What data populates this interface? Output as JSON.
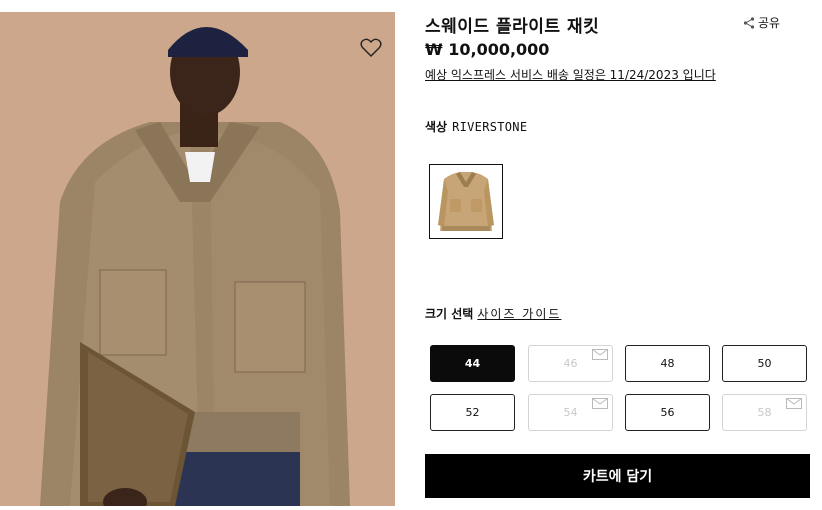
{
  "product": {
    "title": "스웨이드 플라이트 재킷",
    "price": "₩ 10,000,000",
    "delivery_note": "예상 익스프레스 서비스 배송 일정은 11/24/2023 입니다",
    "share_label": "공유"
  },
  "color": {
    "label": "색상",
    "value": "RIVERSTONE",
    "swatch_color": "#c8a576"
  },
  "size": {
    "label": "크기 선택",
    "guide_label": "사이즈 가이드",
    "options": [
      {
        "label": "44",
        "state": "selected"
      },
      {
        "label": "46",
        "state": "unavailable"
      },
      {
        "label": "48",
        "state": "available"
      },
      {
        "label": "50",
        "state": "available"
      },
      {
        "label": "52",
        "state": "available"
      },
      {
        "label": "54",
        "state": "unavailable"
      },
      {
        "label": "56",
        "state": "available"
      },
      {
        "label": "58",
        "state": "unavailable"
      }
    ]
  },
  "cart_button": "카트에 담기",
  "icons": [
    "heart-icon",
    "share-icon",
    "mail-icon"
  ]
}
